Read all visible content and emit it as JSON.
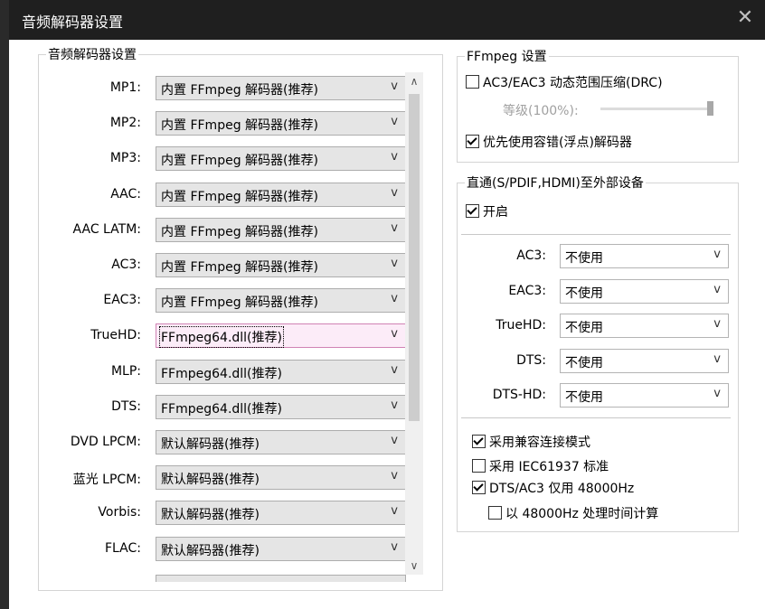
{
  "window": {
    "title": "音频解码器设置"
  },
  "decoder_group": {
    "legend": "音频解码器设置",
    "rows": [
      {
        "label": "MP1:",
        "value": "内置 FFmpeg 解码器(推荐)"
      },
      {
        "label": "MP2:",
        "value": "内置 FFmpeg 解码器(推荐)"
      },
      {
        "label": "MP3:",
        "value": "内置 FFmpeg 解码器(推荐)"
      },
      {
        "label": "AAC:",
        "value": "内置 FFmpeg 解码器(推荐)"
      },
      {
        "label": "AAC LATM:",
        "value": "内置 FFmpeg 解码器(推荐)"
      },
      {
        "label": "AC3:",
        "value": "内置 FFmpeg 解码器(推荐)"
      },
      {
        "label": "EAC3:",
        "value": "内置 FFmpeg 解码器(推荐)"
      },
      {
        "label": "TrueHD:",
        "value": "FFmpeg64.dll(推荐)"
      },
      {
        "label": "MLP:",
        "value": "FFmpeg64.dll(推荐)"
      },
      {
        "label": "DTS:",
        "value": "FFmpeg64.dll(推荐)"
      },
      {
        "label": "DVD LPCM:",
        "value": "默认解码器(推荐)"
      },
      {
        "label": "蓝光 LPCM:",
        "value": "默认解码器(推荐)"
      },
      {
        "label": "Vorbis:",
        "value": "默认解码器(推荐)"
      },
      {
        "label": "FLAC:",
        "value": "默认解码器(推荐)"
      }
    ],
    "dropdown_arrow": "v",
    "scroll_up": "∧",
    "scroll_down": "∨"
  },
  "ffmpeg_group": {
    "legend": "FFmpeg 设置",
    "drc_label": "AC3/EAC3 动态范围压缩(DRC)",
    "drc_checked": false,
    "level_label": "等级(100%):",
    "level_value": 1.0,
    "prefer_float_label": "优先使用容错(浮点)解码器",
    "prefer_float_checked": true
  },
  "passthrough_group": {
    "legend": "直通(S/PDIF,HDMI)至外部设备",
    "enable_label": "开启",
    "enable_checked": true,
    "rows": [
      {
        "label": "AC3:",
        "value": "不使用"
      },
      {
        "label": "EAC3:",
        "value": "不使用"
      },
      {
        "label": "TrueHD:",
        "value": "不使用"
      },
      {
        "label": "DTS:",
        "value": "不使用"
      },
      {
        "label": "DTS-HD:",
        "value": "不使用"
      }
    ],
    "compat_label": "采用兼容连接模式",
    "compat_checked": true,
    "iec_label": "采用 IEC61937 标准",
    "iec_checked": false,
    "dts48_label": "DTS/AC3 仅用 48000Hz",
    "dts48_checked": true,
    "calc48_label": "以 48000Hz 处理时间计算",
    "calc48_checked": false
  }
}
